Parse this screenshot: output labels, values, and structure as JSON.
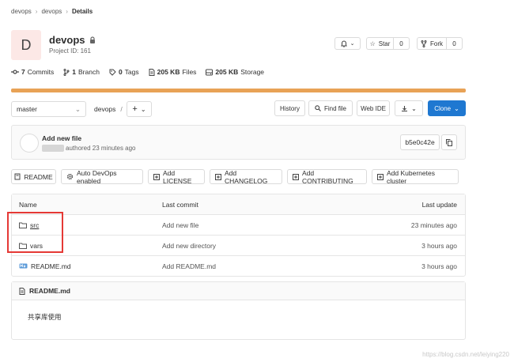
{
  "breadcrumb": [
    "devops",
    "devops",
    "Details"
  ],
  "project": {
    "avatar_letter": "D",
    "name": "devops",
    "id_label": "Project ID: 161"
  },
  "header_buttons": {
    "star_label": "Star",
    "star_count": "0",
    "fork_label": "Fork",
    "fork_count": "0"
  },
  "stats": {
    "commits_n": "7",
    "commits_label": "Commits",
    "branch_n": "1",
    "branch_label": "Branch",
    "tags_n": "0",
    "tags_label": "Tags",
    "files_n": "205 KB",
    "files_label": "Files",
    "storage_n": "205 KB",
    "storage_label": "Storage"
  },
  "toolbar": {
    "branch": "master",
    "path_root": "devops",
    "path_sep": "/",
    "add_label": "+",
    "history": "History",
    "find_file": "Find file",
    "web_ide": "Web IDE",
    "clone": "Clone"
  },
  "last_commit": {
    "title": "Add new file",
    "meta": "authored 23 minutes ago",
    "sha": "b5e0c42e"
  },
  "quick_buttons": [
    "README",
    "Auto DevOps enabled",
    "Add LICENSE",
    "Add CHANGELOG",
    "Add CONTRIBUTING",
    "Add Kubernetes cluster"
  ],
  "table": {
    "headers": {
      "name": "Name",
      "last_commit": "Last commit",
      "last_update": "Last update"
    },
    "rows": [
      {
        "name": "src",
        "commit": "Add new file",
        "update": "23 minutes ago"
      },
      {
        "name": "vars",
        "commit": "Add new directory",
        "update": "3 hours ago"
      },
      {
        "name": "README.md",
        "commit": "Add README.md",
        "update": "3 hours ago"
      }
    ]
  },
  "readme": {
    "title": "README.md",
    "content": "共享库使用"
  },
  "watermark": "https://blog.csdn.net/leiying220",
  "colors": {
    "accent": "#1f78d1",
    "progress": "#e8a256",
    "annotation": "#e53935"
  }
}
